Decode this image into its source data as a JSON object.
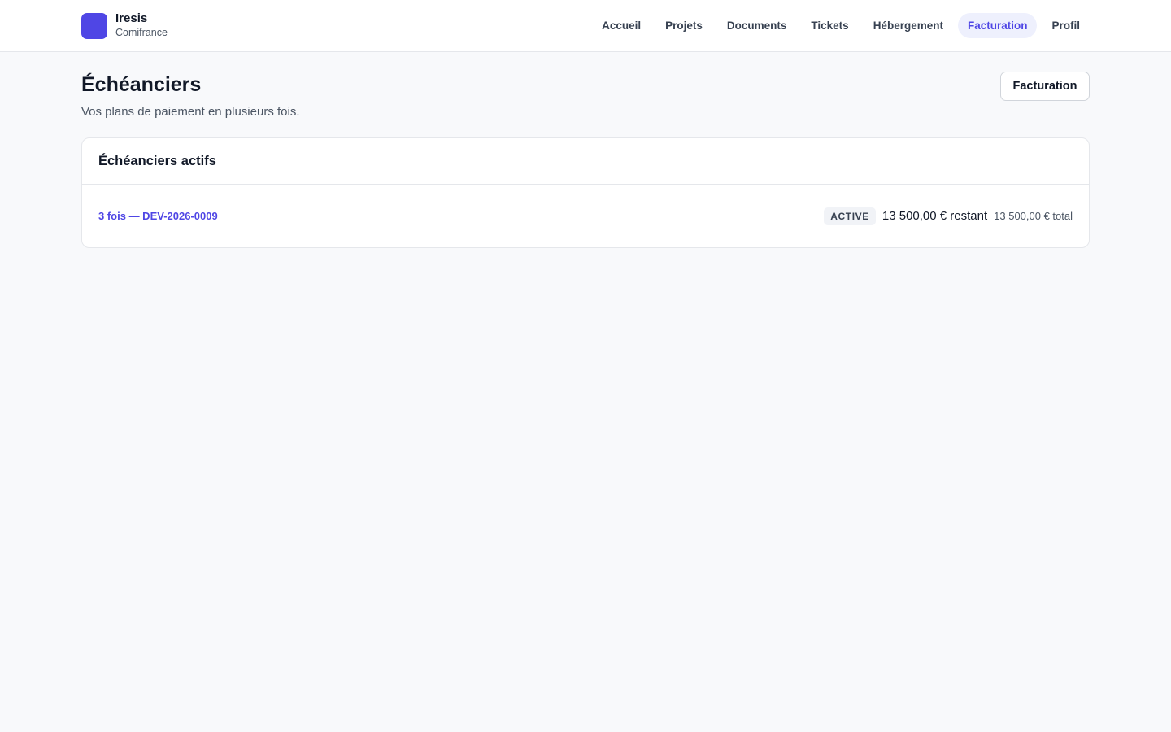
{
  "brand": {
    "name": "Iresis",
    "subtitle": "Comifrance",
    "color": "#4f46e5"
  },
  "nav": {
    "items": [
      {
        "label": "Accueil"
      },
      {
        "label": "Projets"
      },
      {
        "label": "Documents"
      },
      {
        "label": "Tickets"
      },
      {
        "label": "Hébergement"
      },
      {
        "label": "Facturation",
        "active": true
      },
      {
        "label": "Profil"
      }
    ]
  },
  "page": {
    "title": "Échéanciers",
    "subtitle": "Vos plans de paiement en plusieurs fois.",
    "header_button": "Facturation"
  },
  "card": {
    "title": "Échéanciers actifs",
    "plans": [
      {
        "label": "3 fois — DEV-2026-0009",
        "status": "ACTIVE",
        "remaining": "13 500,00 € restant",
        "total": "13 500,00 € total"
      }
    ]
  },
  "colors": {
    "accent": "#4f46e5",
    "background": "#f8f9fb",
    "badge_bg": "#f1f3f7"
  }
}
